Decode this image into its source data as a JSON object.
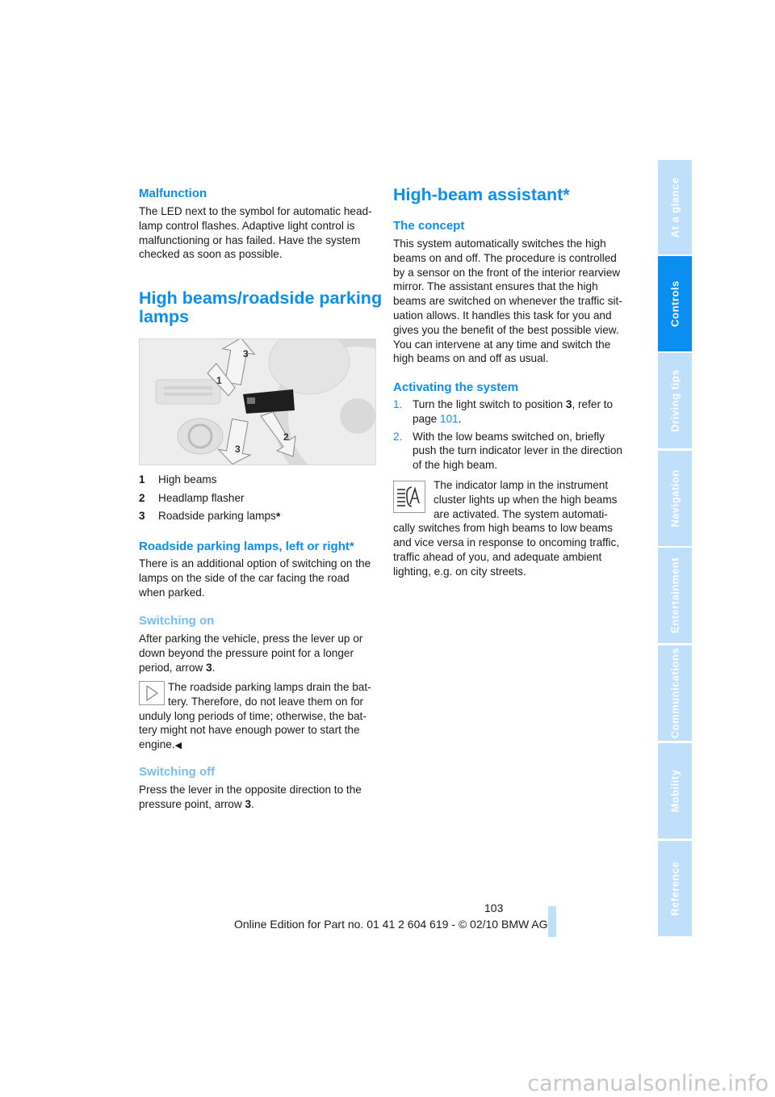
{
  "left": {
    "malfunction": {
      "heading": "Malfunction",
      "lines": [
        "The LED next to the symbol for automatic head-",
        "lamp control flashes. Adaptive light control is",
        "malfunctioning or has failed. Have the system",
        "checked as soon as possible."
      ]
    },
    "high_beams": {
      "heading_line1": "High beams/roadside parking",
      "heading_line2": "lamps"
    },
    "figure": {
      "alt": "Turn indicator lever with arrows 1, 2, 3",
      "labels": [
        "1",
        "2",
        "3",
        "3"
      ],
      "code": "W2C05S09MA"
    },
    "legend": [
      {
        "num": "1",
        "text": "High beams"
      },
      {
        "num": "2",
        "text": "Headlamp flasher"
      },
      {
        "num": "3",
        "text": "Roadside parking lamps",
        "asterisk": "*"
      }
    ],
    "roadside": {
      "heading": "Roadside parking lamps, left or right*",
      "lines": [
        "There is an additional option of switching on the",
        "lamps on the side of the car facing the road",
        "when parked."
      ]
    },
    "switching_on": {
      "heading": "Switching on",
      "lines": [
        "After parking the vehicle, press the lever up or",
        "down beyond the pressure point for a longer"
      ],
      "last_prefix": "period, arrow ",
      "last_bold": "3",
      "last_suffix": ".",
      "note_lines_indented": [
        "The roadside parking lamps drain the bat-",
        "tery. Therefore, do not leave them on for"
      ],
      "note_lines": [
        "unduly long periods of time; otherwise, the bat-",
        "tery might not have enough power to start the"
      ],
      "note_end": "engine.",
      "end_mark": "◀"
    },
    "switching_off": {
      "heading": "Switching off",
      "line1": "Press the lever in the opposite direction to the",
      "line2_prefix": "pressure point, arrow ",
      "line2_bold": "3",
      "line2_suffix": "."
    }
  },
  "right": {
    "heading": "High-beam assistant*",
    "concept": {
      "heading": "The concept",
      "lines": [
        "This system automatically switches the high",
        "beams on and off. The procedure is controlled",
        "by a sensor on the front of the interior rearview",
        "mirror. The assistant ensures that the high",
        "beams are switched on whenever the traffic sit-",
        "uation allows. It handles this task for you and",
        "gives you the benefit of the best possible view.",
        "You can intervene at any time and switch the",
        "high beams on and off as usual."
      ]
    },
    "activating": {
      "heading": "Activating the system",
      "steps": [
        {
          "num": "1.",
          "prefix": "Turn the light switch to position ",
          "bold": "3",
          "mid": ", refer to",
          "line2_prefix": "page ",
          "link": "101",
          "line2_suffix": "."
        },
        {
          "num": "2.",
          "lines": [
            "With the low beams switched on, briefly",
            "push the turn indicator lever in the direction",
            "of the high beam."
          ]
        }
      ]
    },
    "indicator": {
      "lines_indented": [
        "The indicator lamp in the instrument",
        "cluster lights up when the high beams",
        "are activated. The system automati-"
      ],
      "lines": [
        "cally switches from high beams to low beams",
        "and vice versa in response to oncoming traffic,",
        "traffic ahead of you, and adequate ambient",
        "lighting, e.g. on city streets."
      ]
    }
  },
  "tabs": [
    {
      "label": "At a glance",
      "active": false
    },
    {
      "label": "Controls",
      "active": true
    },
    {
      "label": "Driving tips",
      "active": false
    },
    {
      "label": "Navigation",
      "active": false
    },
    {
      "label": "Entertainment",
      "active": false
    },
    {
      "label": "Communications",
      "active": false
    },
    {
      "label": "Mobility",
      "active": false
    },
    {
      "label": "Reference",
      "active": false
    }
  ],
  "page_number": "103",
  "footer": "Online Edition for Part no. 01 41 2 604 619 - © 02/10 BMW AG",
  "watermark": "carmanualsonline.info",
  "colors": {
    "accent": "#0a8ff0",
    "light_accent": "#76bdf4",
    "tab_inactive": "#bfdffb"
  }
}
